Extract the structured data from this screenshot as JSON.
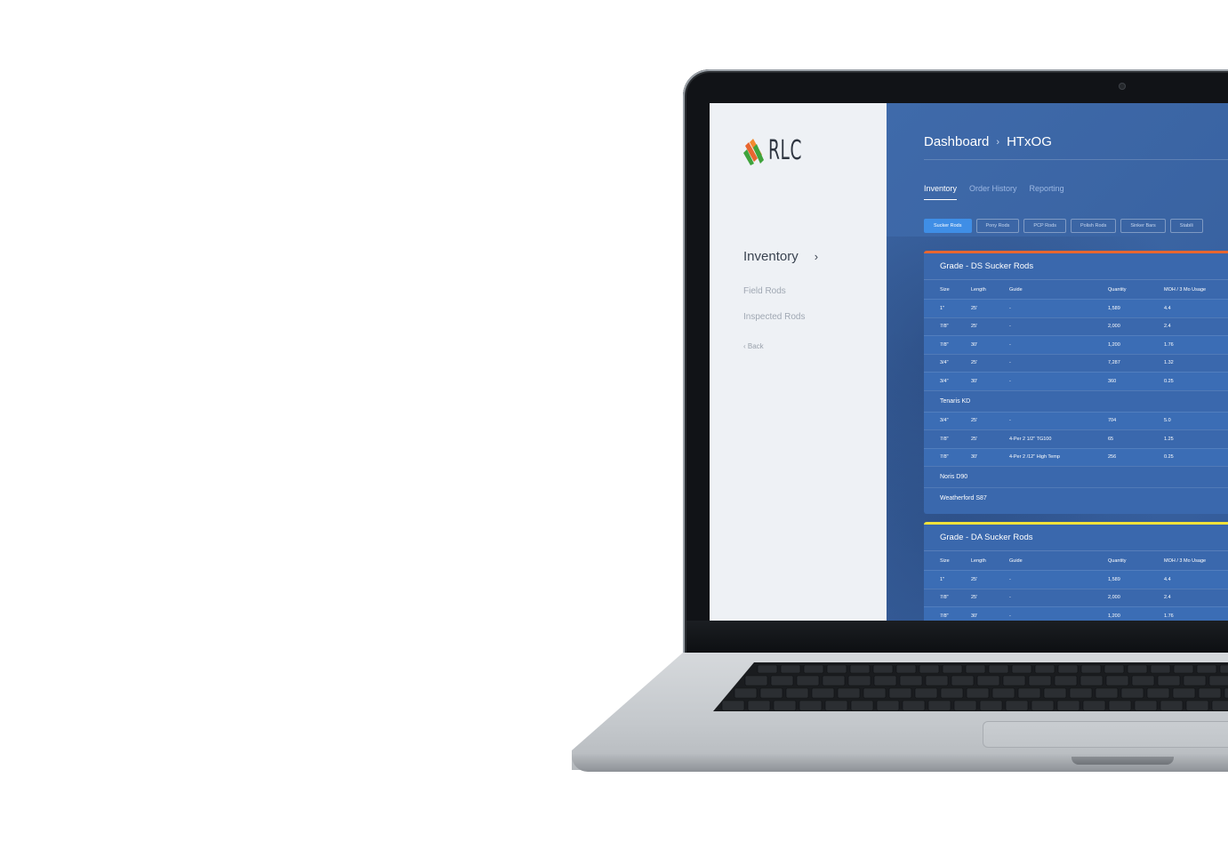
{
  "sidebar": {
    "logo_text": "RLC",
    "nav_main": "Inventory",
    "nav_items": [
      "Field Rods",
      "Inspected Rods"
    ],
    "back": "Back"
  },
  "header": {
    "breadcrumb_root": "Dashboard",
    "breadcrumb_current": "HTxOG"
  },
  "tabs": [
    {
      "label": "Inventory",
      "active": true
    },
    {
      "label": "Order History",
      "active": false
    },
    {
      "label": "Reporting",
      "active": false
    }
  ],
  "filters": [
    {
      "label": "Sucker Rods",
      "active": true
    },
    {
      "label": "Pony Rods",
      "active": false
    },
    {
      "label": "PCP Rods",
      "active": false
    },
    {
      "label": "Polish Rods",
      "active": false
    },
    {
      "label": "Sinker Bars",
      "active": false
    },
    {
      "label": "Stabili",
      "active": false
    }
  ],
  "columns": [
    "Size",
    "Length",
    "Guide",
    "Quantity",
    "MOH / 3 Mo Usage"
  ],
  "cards": [
    {
      "title": "Grade - DS Sucker Rods",
      "accent": "#e8662f",
      "rows": [
        [
          "1\"",
          "25'",
          "-",
          "1,589",
          "4.4"
        ],
        [
          "7/8\"",
          "25'",
          "-",
          "2,000",
          "2.4"
        ],
        [
          "7/8\"",
          "30'",
          "-",
          "1,200",
          "1.76"
        ],
        [
          "3/4\"",
          "25'",
          "-",
          "7,287",
          "1.32"
        ],
        [
          "3/4\"",
          "30'",
          "-",
          "360",
          "0.25"
        ]
      ],
      "group_1": "Tenaris KD",
      "group_1_rows": [
        [
          "3/4\"",
          "25'",
          "-",
          "704",
          "5.0"
        ],
        [
          "7/8\"",
          "25'",
          "4-Per 2 1/2\" TG100",
          "65",
          "1.25"
        ],
        [
          "7/8\"",
          "30'",
          "4-Per 2 /12\" High Temp",
          "256",
          "0.25"
        ]
      ],
      "group_2": "Noris D90",
      "group_3": "Weatherford S87"
    },
    {
      "title": "Grade - DA Sucker Rods",
      "accent": "#f1e23a",
      "rows": [
        [
          "1\"",
          "25'",
          "-",
          "1,589",
          "4.4"
        ],
        [
          "7/8\"",
          "25'",
          "-",
          "2,000",
          "2.4"
        ],
        [
          "7/8\"",
          "30'",
          "-",
          "1,200",
          "1.76"
        ]
      ]
    }
  ]
}
